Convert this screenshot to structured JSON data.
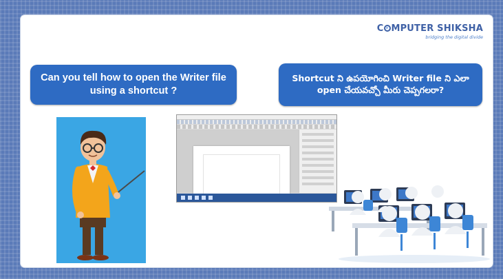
{
  "logo": {
    "brand_pre": "C",
    "brand_post": "MPUTER SHIKSHA",
    "tagline": "bridging the digital divide"
  },
  "questions": {
    "english": "Can you tell how to open the Writer file using a shortcut ?",
    "telugu": "Shortcut ని ఉపయోగించి Writer file ని ఎలా open చేయవచ్చో మీరు చెప్పగలరా?"
  },
  "illustrations": {
    "teacher": "teacher-pointing",
    "writer_window": "libreoffice-writer-window",
    "computer_lab": "students-at-computers"
  },
  "colors": {
    "bubble": "#2e6bc3",
    "teacher_bg": "#3aa6e4",
    "slide_border": "#5b7bb8",
    "logo": "#3f61a6"
  }
}
